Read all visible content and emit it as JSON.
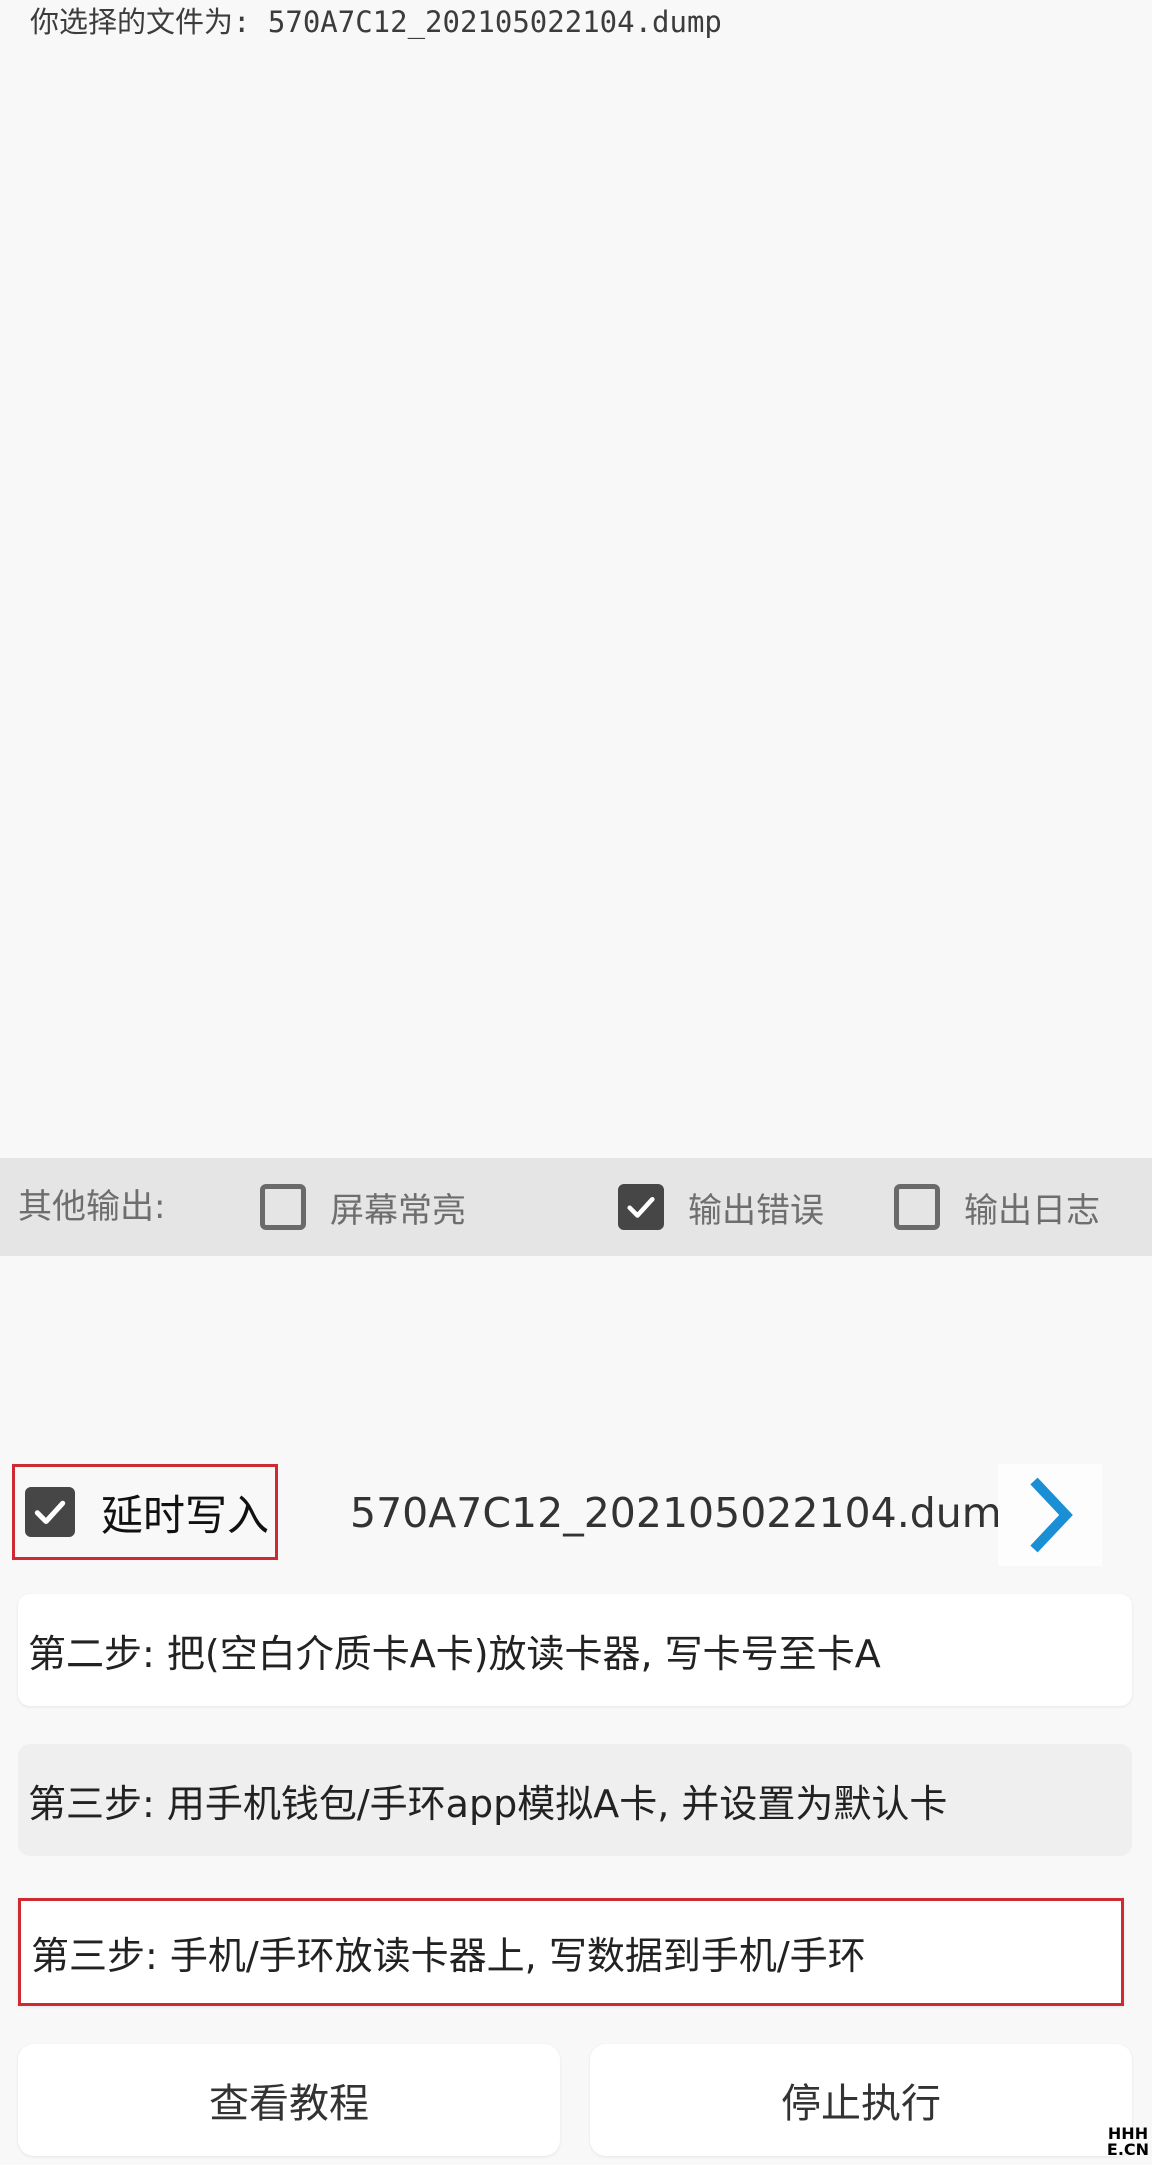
{
  "log": {
    "selected_file_text": "你选择的文件为: 570A7C12_202105022104.dump"
  },
  "output_options": {
    "label": "其他输出:",
    "options": [
      {
        "label": "屏幕常亮",
        "checked": false
      },
      {
        "label": "输出错误",
        "checked": true
      },
      {
        "label": "输出日志",
        "checked": false
      }
    ]
  },
  "delay_write": {
    "label": "延时写入",
    "checked": true
  },
  "file": {
    "name": "570A7C12_202105022104.dump",
    "next_icon": "chevron-right-icon"
  },
  "steps": [
    {
      "label": "第二步: 把(空白介质卡A卡)放读卡器, 写卡号至卡A"
    },
    {
      "label": "第三步: 用手机钱包/手环app模拟A卡, 并设置为默认卡"
    },
    {
      "label": "第三步: 手机/手环放读卡器上, 写数据到手机/手环"
    }
  ],
  "buttons": {
    "tutorial": "查看教程",
    "stop": "停止执行"
  },
  "watermark": {
    "line1": "HHH",
    "line2": "E.CN"
  },
  "colors": {
    "accent": "#1a8fd6",
    "highlight_border": "#cf2a31",
    "checkbox_checked": "#464646"
  }
}
